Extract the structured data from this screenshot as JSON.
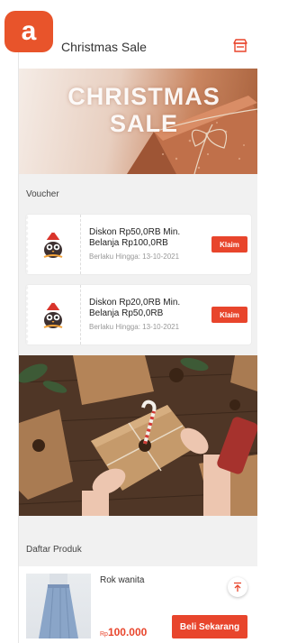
{
  "badge": {
    "letter": "a"
  },
  "header": {
    "title": "Christmas Sale",
    "store_icon": "store-icon"
  },
  "banner": {
    "title_line1": "CHRISTMAS",
    "title_line2": "SALE"
  },
  "voucher_section": {
    "label": "Voucher"
  },
  "vouchers": [
    {
      "title_line1": "Diskon Rp50,0RB Min.",
      "title_line2": "Belanja Rp100,0RB",
      "valid_until": "Berlaku Hingga: 13-10-2021",
      "button": "Klaim",
      "icon": "santa-owl-icon"
    },
    {
      "title_line1": "Diskon Rp20,0RB Min.",
      "title_line2": "Belanja Rp50,0RB",
      "valid_until": "Berlaku Hingga: 13-10-2021",
      "button": "Klaim",
      "icon": "santa-owl-icon"
    }
  ],
  "product_section": {
    "label": "Daftar Produk"
  },
  "products": [
    {
      "name": "Rok wanita",
      "currency": "Rp",
      "price": "100.000",
      "button": "Beli Sekarang"
    }
  ],
  "colors": {
    "accent": "#e8452c",
    "badge": "#e8542b",
    "background": "#f1f1f1"
  }
}
